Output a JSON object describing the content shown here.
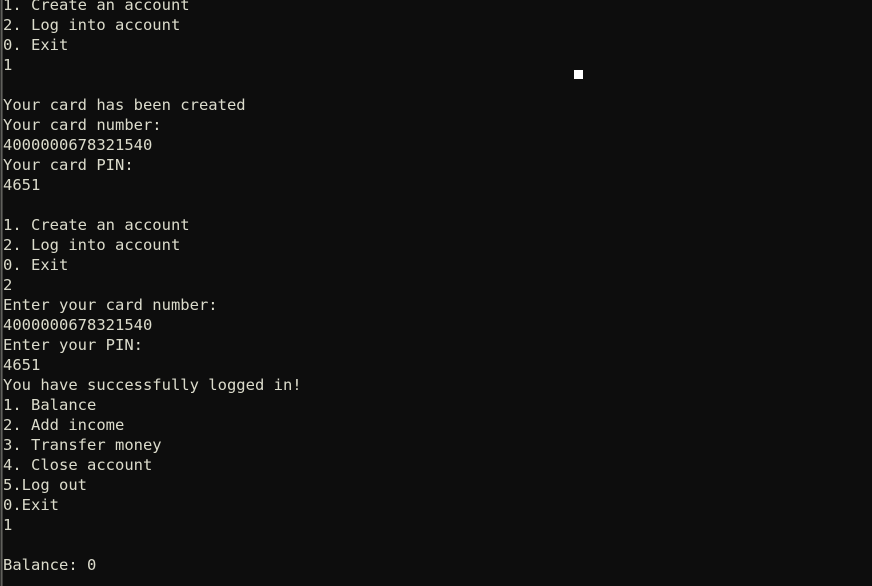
{
  "terminal": {
    "background_color": "#0d0d0d",
    "text_color": "#dcdccc",
    "cursor_color": "#ffffff",
    "lines": [
      "1. Create an account",
      "2. Log into account",
      "0. Exit",
      "1",
      "",
      "Your card has been created",
      "Your card number:",
      "4000000678321540",
      "Your card PIN:",
      "4651",
      "",
      "1. Create an account",
      "2. Log into account",
      "0. Exit",
      "2",
      "Enter your card number:",
      "4000000678321540",
      "Enter your PIN:",
      "4651",
      "You have successfully logged in!",
      "1. Balance",
      "2. Add income",
      "3. Transfer money",
      "4. Close account",
      "5.Log out",
      "0.Exit",
      "1",
      "",
      "Balance: 0"
    ],
    "main_menu": {
      "options": [
        "1. Create an account",
        "2. Log into account",
        "0. Exit"
      ]
    },
    "account_menu": {
      "options": [
        "1. Balance",
        "2. Add income",
        "3. Transfer money",
        "4. Close account",
        "5.Log out",
        "0.Exit"
      ]
    },
    "session": {
      "card_created_message": "Your card has been created",
      "card_number_prompt": "Your card number:",
      "card_number": "4000000678321540",
      "card_pin_prompt": "Your card PIN:",
      "card_pin": "4651",
      "enter_card_number_prompt": "Enter your card number:",
      "enter_pin_prompt": "Enter your PIN:",
      "login_success_message": "You have successfully logged in!",
      "balance_line": "Balance: 0",
      "balance_value": "0",
      "user_inputs": [
        "1",
        "2",
        "4000000678321540",
        "4651",
        "1"
      ]
    }
  }
}
